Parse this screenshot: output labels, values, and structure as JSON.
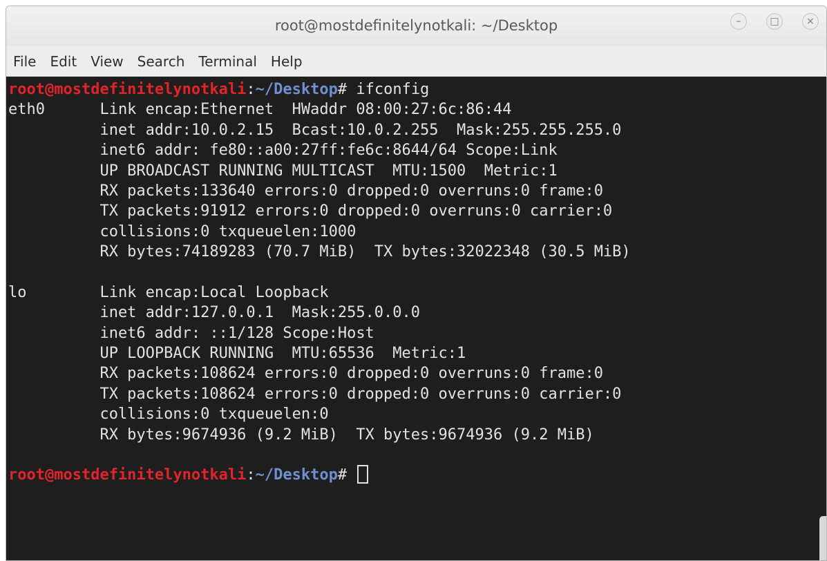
{
  "window": {
    "title": "root@mostdefinitelynotkali: ~/Desktop",
    "controls": {
      "minimize": "–",
      "maximize": "□",
      "close": "×"
    }
  },
  "menubar": {
    "items": [
      "File",
      "Edit",
      "View",
      "Search",
      "Terminal",
      "Help"
    ]
  },
  "terminal": {
    "prompt": {
      "user_host": "root@mostdefinitelynotkali",
      "sep": ":",
      "path": "~/Desktop",
      "symbol": "# "
    },
    "command": "ifconfig",
    "output": [
      "eth0      Link encap:Ethernet  HWaddr 08:00:27:6c:86:44  ",
      "          inet addr:10.0.2.15  Bcast:10.0.2.255  Mask:255.255.255.0",
      "          inet6 addr: fe80::a00:27ff:fe6c:8644/64 Scope:Link",
      "          UP BROADCAST RUNNING MULTICAST  MTU:1500  Metric:1",
      "          RX packets:133640 errors:0 dropped:0 overruns:0 frame:0",
      "          TX packets:91912 errors:0 dropped:0 overruns:0 carrier:0",
      "          collisions:0 txqueuelen:1000 ",
      "          RX bytes:74189283 (70.7 MiB)  TX bytes:32022348 (30.5 MiB)",
      "",
      "lo        Link encap:Local Loopback  ",
      "          inet addr:127.0.0.1  Mask:255.0.0.0",
      "          inet6 addr: ::1/128 Scope:Host",
      "          UP LOOPBACK RUNNING  MTU:65536  Metric:1",
      "          RX packets:108624 errors:0 dropped:0 overruns:0 frame:0",
      "          TX packets:108624 errors:0 dropped:0 overruns:0 carrier:0",
      "          collisions:0 txqueuelen:0 ",
      "          RX bytes:9674936 (9.2 MiB)  TX bytes:9674936 (9.2 MiB)",
      ""
    ]
  },
  "colors": {
    "terminal_bg": "#1e1e1e",
    "terminal_fg": "#e2e2e2",
    "prompt_user": "#e0242a",
    "prompt_path": "#6f8fcf"
  }
}
